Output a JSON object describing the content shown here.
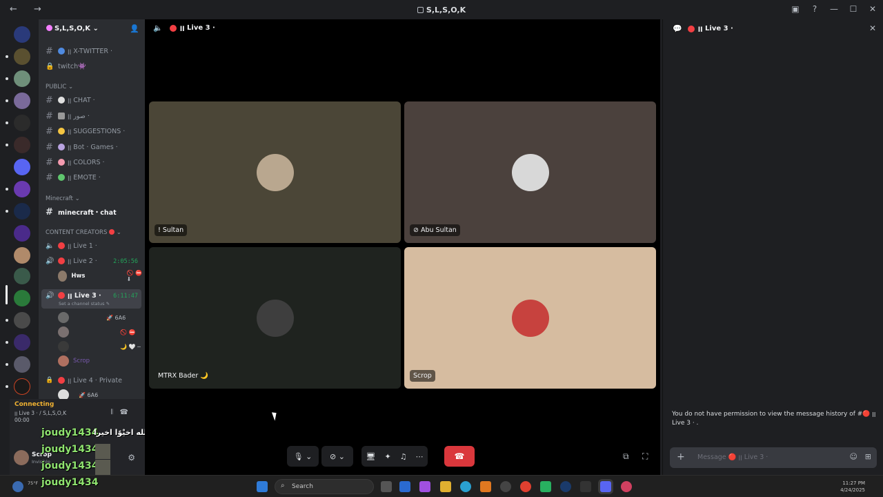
{
  "window": {
    "title": "S,L,S,O,K",
    "nav": "← →",
    "controls": [
      "▣",
      "?",
      "—",
      "☐",
      "✕"
    ]
  },
  "guild": {
    "name": "S,L,S,O,K",
    "channels_top": [
      {
        "label": "ꞁꞁ X-TWITTER ·"
      },
      {
        "label": "twitch👾"
      }
    ],
    "public_category": "PUBLIC",
    "public_channels": [
      {
        "label": "ꞁꞁ CHAT ·"
      },
      {
        "label": "ꞁꞁ صور ·"
      },
      {
        "label": "ꞁꞁ SUGGESTIONS ·"
      },
      {
        "label": "ꞁꞁ Bot · Games ·"
      },
      {
        "label": "ꞁꞁ COLORS ·"
      },
      {
        "label": "ꞁꞁ EMOTE ·"
      }
    ],
    "minecraft_category": "Minecraft",
    "minecraft_channel": "minecraft・chat",
    "creators_category": "CONTENT CREATORS",
    "voice": {
      "live1": "ꞁꞁ Live 1 ·",
      "live2": "ꞁꞁ Live 2 ·",
      "live2_timer": "2:05:56",
      "live2_member": "Hws",
      "live3": "ꞁꞁ Live 3 ·",
      "live3_timer": "6:11:47",
      "live3_status": "Set a channel status",
      "live3_members": [
        "",
        "",
        "",
        "Scrop"
      ],
      "live3_badge1": "6A6",
      "live4": "ꞁꞁ Live 4 · Private",
      "live4_badge": "6A6"
    }
  },
  "user_panel": {
    "connecting": "Connecting",
    "voice_channel": "ꞁꞁ Live 3 · / S,L,S,O,K",
    "time": "00:00",
    "username": "Scrop",
    "status": "Invisible"
  },
  "overlay": {
    "lines": [
      "joudy1434",
      "joudy1434",
      "joudy1434",
      "joudy1434"
    ],
    "arabic": "الله اخيْوًا اخيرا"
  },
  "stage": {
    "header": "ꞁꞁ Live 3 ·",
    "tiles": [
      {
        "name": "! Sultan",
        "bg": "#4b4637",
        "av": "#b9a78f"
      },
      {
        "name": "Abu Sultan",
        "bg": "#4b413d",
        "av": "#d8d8d8"
      },
      {
        "name": "MTRX Bader 🌙",
        "bg": "#1f231f",
        "av": "#3e3e3e"
      },
      {
        "name": "Scrop",
        "bg": "#d6bca0",
        "av": "#c7423e"
      }
    ]
  },
  "chat": {
    "header": "ꞁꞁ Live 3 ·",
    "permission_text": "You do not have permission to view the message history of #🔴 ꞁꞁ Live 3 · .",
    "placeholder": "Message 🔴 ꞁꞁ Live 3 ·"
  },
  "taskbar": {
    "search_placeholder": "Search",
    "weather": "75°F",
    "time": "11:27 PM",
    "date": "4/24/2025"
  },
  "colors": {
    "accent_red": "#da373c",
    "voice_green": "#23a55a",
    "connecting_yellow": "#f0b232"
  }
}
